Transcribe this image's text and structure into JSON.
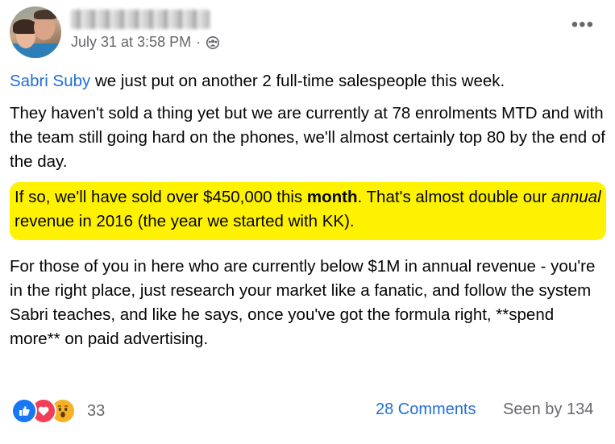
{
  "post": {
    "author_name": "Blurred name",
    "timestamp": "July 31 at 3:58 PM",
    "separator": "·",
    "audience_icon": "group-icon",
    "more_icon": "more-icon",
    "more_label": "•••"
  },
  "content": {
    "p1_tag": "Sabri Suby",
    "p1_text": " we just put on another 2 full-time salespeople this week.",
    "p2": "They haven't sold a thing yet but we are currently at 78 enrolments MTD and with the team still going hard on the phones, we'll almost certainly top 80 by the end of the day.",
    "p3_a": "If so, we'll have sold over $450,000 this ",
    "p3_bold": "month",
    "p3_b": ". That's almost double our ",
    "p3_italic": "annual",
    "p3_c": " revenue in 2016 (the year we started with KK).",
    "p4": "For those of you in here who are currently below $1M in annual revenue - you're in the right place, just research your market like a fanatic, and follow the system Sabri teaches, and like he says, once you've got the formula right, **spend more** on paid advertising."
  },
  "footer": {
    "reaction_icons": [
      "like-icon",
      "love-icon",
      "wow-icon"
    ],
    "reaction_count": "33",
    "comments_label": "28 Comments",
    "seen_label": "Seen by 134"
  },
  "colors": {
    "link": "#216fdb",
    "highlight": "#fff200",
    "meta_text": "#65676b"
  }
}
